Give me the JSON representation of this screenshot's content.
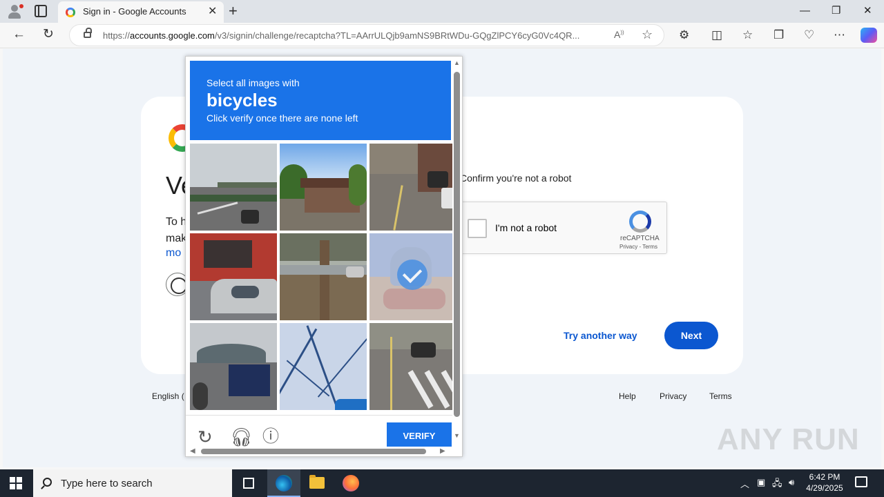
{
  "browser": {
    "tab_title": "Sign in - Google Accounts",
    "tab_close": "✕",
    "new_tab": "+",
    "url_prefix": "https://",
    "url_domain": "accounts.google.com",
    "url_path": "/v3/signin/challenge/recaptcha?TL=AArrULQjb9amNS9BRtWDu-GQgZlPCY6cyG0Vc4QR...",
    "read_aloud": "A⁰",
    "minimize": "—",
    "maximize": "❐",
    "close": "✕"
  },
  "signin": {
    "heading": "Ve",
    "para_line1": "To h",
    "para_line2": "mak",
    "more_link": "mo",
    "confirm_text": "Confirm you're not a robot",
    "recaptcha_label": "I'm not a robot",
    "recaptcha_name": "reCAPTCHA",
    "recaptcha_links": "Privacy - Terms",
    "try_another": "Try another way",
    "next": "Next",
    "footer_lang": "English (",
    "footer_help": "Help",
    "footer_privacy": "Privacy",
    "footer_terms": "Terms"
  },
  "challenge": {
    "instruction": "Select all images with",
    "object": "bicycles",
    "subtext": "Click verify once there are none left",
    "verify": "VERIFY",
    "tiles": [
      {
        "label": "overpass-road",
        "selected": false
      },
      {
        "label": "houses-trees",
        "selected": false
      },
      {
        "label": "street-cars",
        "selected": false
      },
      {
        "label": "bus-and-car",
        "selected": false
      },
      {
        "label": "tree-street",
        "selected": false
      },
      {
        "label": "motorcycle-rider",
        "selected": true
      },
      {
        "label": "stadium-truck",
        "selected": false
      },
      {
        "label": "tree-shadow",
        "selected": false
      },
      {
        "label": "crosswalk-cars",
        "selected": false
      }
    ]
  },
  "watermark": "ANY RUN",
  "taskbar": {
    "search_placeholder": "Type here to search",
    "time": "6:42 PM",
    "date": "4/29/2025"
  },
  "colors": {
    "challenge_blue": "#1a73e8",
    "next_blue": "#0b57d0",
    "taskbar": "#1d2530"
  }
}
